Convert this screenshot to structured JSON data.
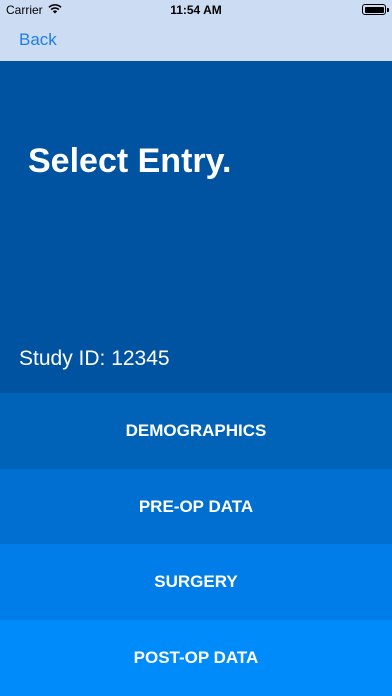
{
  "status_bar": {
    "carrier": "Carrier",
    "time": "11:54 AM",
    "wifi_icon": "wifi-icon",
    "battery_icon": "battery-icon"
  },
  "nav": {
    "back_label": "Back"
  },
  "hero": {
    "title": "Select Entry.",
    "study_id": "Study ID: 12345"
  },
  "menu": {
    "items": [
      {
        "label": "DEMOGRAPHICS",
        "color": "#0063b8"
      },
      {
        "label": "PRE-OP DATA",
        "color": "#006fd2"
      },
      {
        "label": "SURGERY",
        "color": "#007de8"
      },
      {
        "label": "POST-OP DATA",
        "color": "#008bfb"
      }
    ]
  },
  "colors": {
    "header_bg": "#ccdcf2",
    "hero_bg": "#0053a0",
    "link": "#1f7ee8"
  }
}
